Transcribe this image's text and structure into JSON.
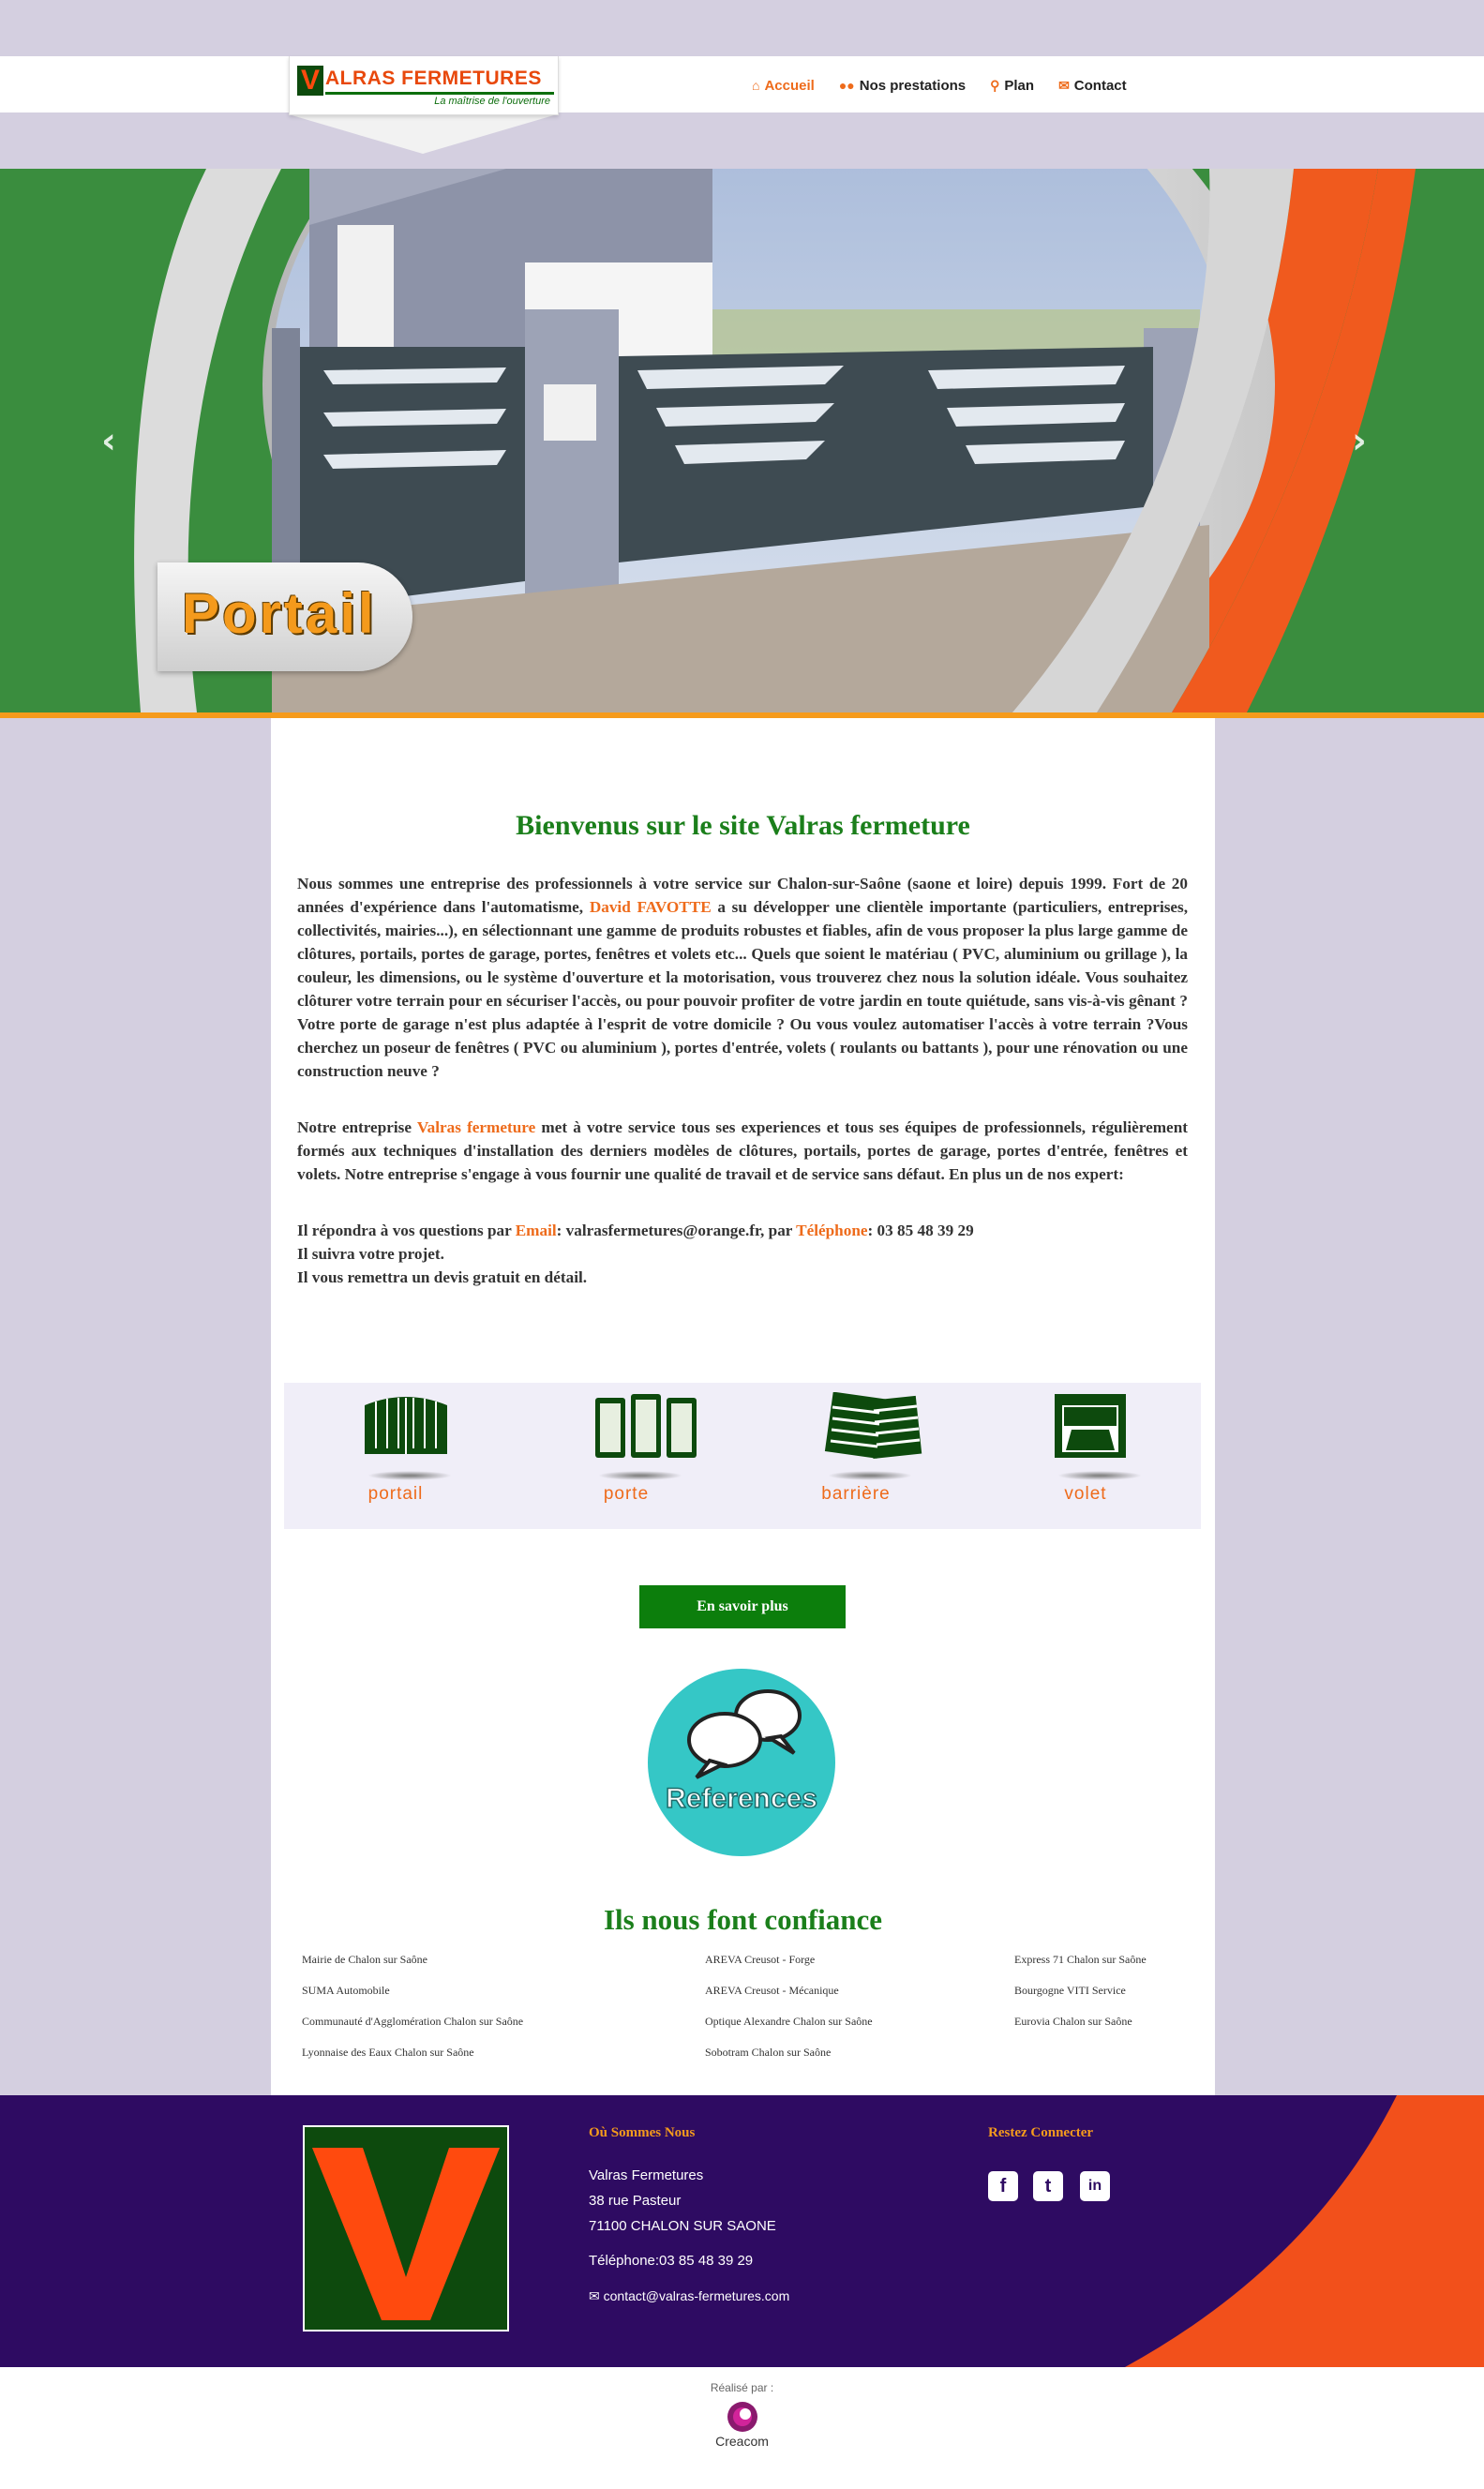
{
  "header": {
    "brand": "ALRAS FERMETURES",
    "brand_initial": "V",
    "tagline": "La maîtrise de l'ouverture",
    "nav": [
      {
        "label": "Accueil",
        "icon": "home-icon",
        "active": true
      },
      {
        "label": "Nos prestations",
        "icon": "users-icon",
        "active": false
      },
      {
        "label": "Plan",
        "icon": "map-marker-icon",
        "active": false
      },
      {
        "label": "Contact",
        "icon": "envelope-icon",
        "active": false
      }
    ]
  },
  "hero": {
    "caption": "Portail",
    "prev_icon": "chevron-left-icon",
    "next_icon": "chevron-right-icon"
  },
  "welcome": {
    "title": "Bienvenus sur le site Valras fermeture",
    "p1_a": "Nous sommes une entreprise des professionnels à votre service sur Chalon-sur-Saône (saone et loire) depuis 1999. Fort de 20 années d'expérience dans l'automatisme,",
    "p1_name": "David FAVOTTE",
    "p1_b": "a su développer une clientèle importante (particuliers, entreprises, collectivités, mairies...), en sélectionnant une gamme de produits robustes et fiables, afin de vous proposer la plus large gamme de clôtures, portails, portes de garage, portes, fenêtres et volets etc... Quels que soient le matériau ( PVC, aluminium ou grillage ), la couleur, les dimensions, ou le système d'ouverture et la motorisation, vous trouverez chez nous la solution idéale. Vous souhaitez clôturer votre terrain pour en sécuriser l'accès, ou pour pouvoir profiter de votre jardin en toute quiétude, sans vis-à-vis gênant ? Votre porte de garage n'est plus adaptée à l'esprit de votre domicile ? Ou vous voulez automatiser l'accès à votre terrain ?Vous cherchez un poseur de fenêtres ( PVC ou aluminium ), portes d'entrée, volets ( roulants ou battants ), pour une rénovation ou une construction neuve ?",
    "p2_a": "Notre entreprise",
    "p2_name": "Valras fermeture",
    "p2_b": "met à votre service tous ses experiences et tous ses équipes de professionnels, régulièrement formés aux techniques d'installation des derniers modèles de clôtures, portails, portes de garage, portes d'entrée, fenêtres et volets. Notre entreprise s'engage à vous fournir une qualité de travail et de service sans défaut. En plus un de nos expert:",
    "p3_a": "Il répondra à vos questions par",
    "p3_email_label": "Email",
    "p3_email": ": valrasfermetures@orange.fr, par",
    "p3_phone_label": "Téléphone",
    "p3_phone": ": 03 85 48 39 29",
    "p3_line2": "Il suivra votre projet.",
    "p3_line3": "Il vous remettra un devis gratuit en détail."
  },
  "services": [
    {
      "label": "portail",
      "icon": "gate-icon"
    },
    {
      "label": "porte",
      "icon": "doors-icon"
    },
    {
      "label": "barrière",
      "icon": "shutters-icon"
    },
    {
      "label": "volet",
      "icon": "garage-door-icon"
    }
  ],
  "more_button": "En savoir plus",
  "references": {
    "badge": "References",
    "title": "Ils nous font confiance",
    "col1": [
      "Mairie de Chalon sur Saône",
      "SUMA Automobile",
      "Communauté d'Agglomération Chalon sur Saône",
      "Lyonnaise des Eaux Chalon sur Saône"
    ],
    "col2": [
      "AREVA Creusot - Forge",
      "AREVA Creusot - Mécanique",
      "Optique Alexandre Chalon sur Saône",
      "Sobotram Chalon sur Saône"
    ],
    "col3": [
      "Express 71 Chalon sur Saône",
      "Bourgogne VITI Service",
      "Eurovia Chalon sur Saône"
    ]
  },
  "footer": {
    "address_title": "Où Sommes Nous",
    "company": "Valras Fermetures",
    "street": "38 rue Pasteur",
    "city": "71100 CHALON SUR SAONE",
    "phone": "Téléphone:03 85 48 39 29",
    "email": "contact@valras-fermetures.com",
    "social_title": "Restez Connecter",
    "social": [
      {
        "icon": "facebook-icon",
        "glyph": "f"
      },
      {
        "icon": "twitter-icon",
        "glyph": "t"
      },
      {
        "icon": "linkedin-icon",
        "glyph": "in"
      }
    ]
  },
  "credit": {
    "made_by": "Réalisé par :",
    "agency": "Creacom"
  },
  "colors": {
    "accent_orange": "#ee6b1b",
    "brand_green": "#0c7e0c",
    "footer_purple": "#2e0b62",
    "background": "#d4cfe0"
  }
}
